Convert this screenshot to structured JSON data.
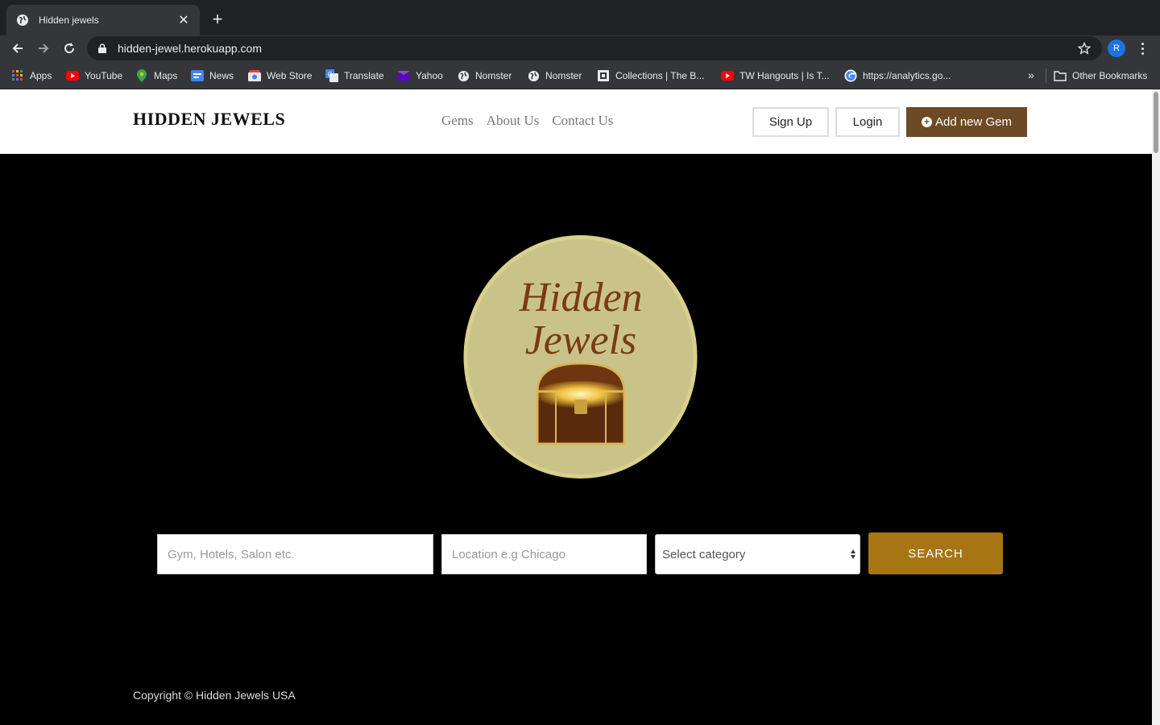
{
  "browser": {
    "tab_title": "Hidden jewels",
    "tab_close": "✕",
    "new_tab": "+",
    "url": "hidden-jewel.herokuapp.com",
    "profile_initial": "R",
    "bookmarks": [
      {
        "label": "Apps",
        "icon": "apps-grid-icon"
      },
      {
        "label": "YouTube",
        "icon": "youtube-icon"
      },
      {
        "label": "Maps",
        "icon": "maps-pin-icon"
      },
      {
        "label": "News",
        "icon": "news-icon"
      },
      {
        "label": "Web Store",
        "icon": "web-store-icon"
      },
      {
        "label": "Translate",
        "icon": "translate-icon"
      },
      {
        "label": "Yahoo",
        "icon": "yahoo-icon"
      },
      {
        "label": "Nomster",
        "icon": "globe-icon"
      },
      {
        "label": "Nomster",
        "icon": "globe-icon"
      },
      {
        "label": "Collections | The B...",
        "icon": "collections-icon"
      },
      {
        "label": "TW Hangouts | Is T...",
        "icon": "youtube-icon"
      },
      {
        "label": "https://analytics.go...",
        "icon": "google-icon"
      }
    ],
    "bookmarks_overflow": "»",
    "other_bookmarks": "Other Bookmarks"
  },
  "header": {
    "brand": "HIDDEN JEWELS",
    "nav": [
      "Gems",
      "About Us",
      "Contact Us"
    ],
    "signup_label": "Sign Up",
    "login_label": "Login",
    "add_gem_label": "Add new Gem"
  },
  "hero": {
    "logo_line1": "Hidden",
    "logo_line2": "Jewels",
    "search_placeholder": "Gym, Hotels, Salon etc.",
    "location_placeholder": "Location e.g Chicago",
    "category_selected": "Select category",
    "search_button": "SEARCH"
  },
  "footer": {
    "copyright": "Copyright © Hidden Jewels USA"
  },
  "colors": {
    "add_button": "#6b4a25",
    "search_button": "#a87514",
    "logo_circle": "#c9c38a",
    "logo_text": "#7a3a12"
  }
}
